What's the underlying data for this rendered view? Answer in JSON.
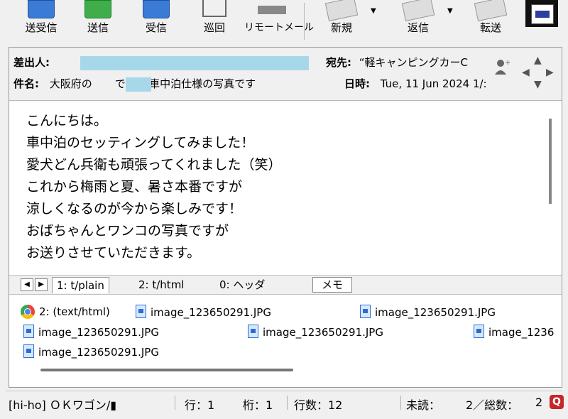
{
  "toolbar": {
    "send_receive": "送受信",
    "send": "送信",
    "receive": "受信",
    "patrol": "巡回",
    "remote_mail": "リモートメール",
    "new": "新規",
    "reply": "返信",
    "forward": "転送",
    "icons": [
      "send-receive-icon",
      "send-icon",
      "receive-icon",
      "patrol-icon",
      "remote-mail-icon",
      "new-icon",
      "reply-icon",
      "forward-icon",
      "window-icon"
    ]
  },
  "header": {
    "from_label": "差出人:",
    "to_label": "宛先:",
    "to_value": "“軽キャンピングカーC",
    "subject_label": "件名:",
    "subject_prefix": "大阪府の",
    "subject_suffix": "です。 車中泊仕様の写真です",
    "date_label": "日時:",
    "date_value": "Tue, 11 Jun 2024 1/:"
  },
  "body": {
    "lines": [
      "こんにちは。",
      "車中泊のセッティングしてみました！",
      "愛犬どん兵衛も頑張ってくれました（笑）",
      "これから梅雨と夏、暑さ本番ですが",
      "涼しくなるのが今から楽しみです！",
      "おばちゃんとワンコの写真ですが",
      "お送りさせていただきます。"
    ]
  },
  "tabs": {
    "items": [
      "1: t/plain",
      "2: t/html",
      "0: ヘッダ"
    ],
    "memo": "メモ"
  },
  "attachments": {
    "html_part": "2: (text/html)",
    "files": [
      "image_123650291.JPG",
      "image_123650291.JPG",
      "image_123650291.JPG",
      "image_123650291.JPG",
      "image_1236",
      "image_123650291.JPG"
    ]
  },
  "status": {
    "mailbox": "[hi-ho] ＯＫワゴン/▮",
    "row": "行：1",
    "column": "桁：1",
    "line_count": "行数：12",
    "unread": "未読：",
    "totals": "2／総数：",
    "total_value": "2",
    "q_icon": "Q"
  },
  "colors": {
    "redaction": "#a6d8ea",
    "title_strip": "#b5dde8",
    "accent_red": "#c62828"
  }
}
